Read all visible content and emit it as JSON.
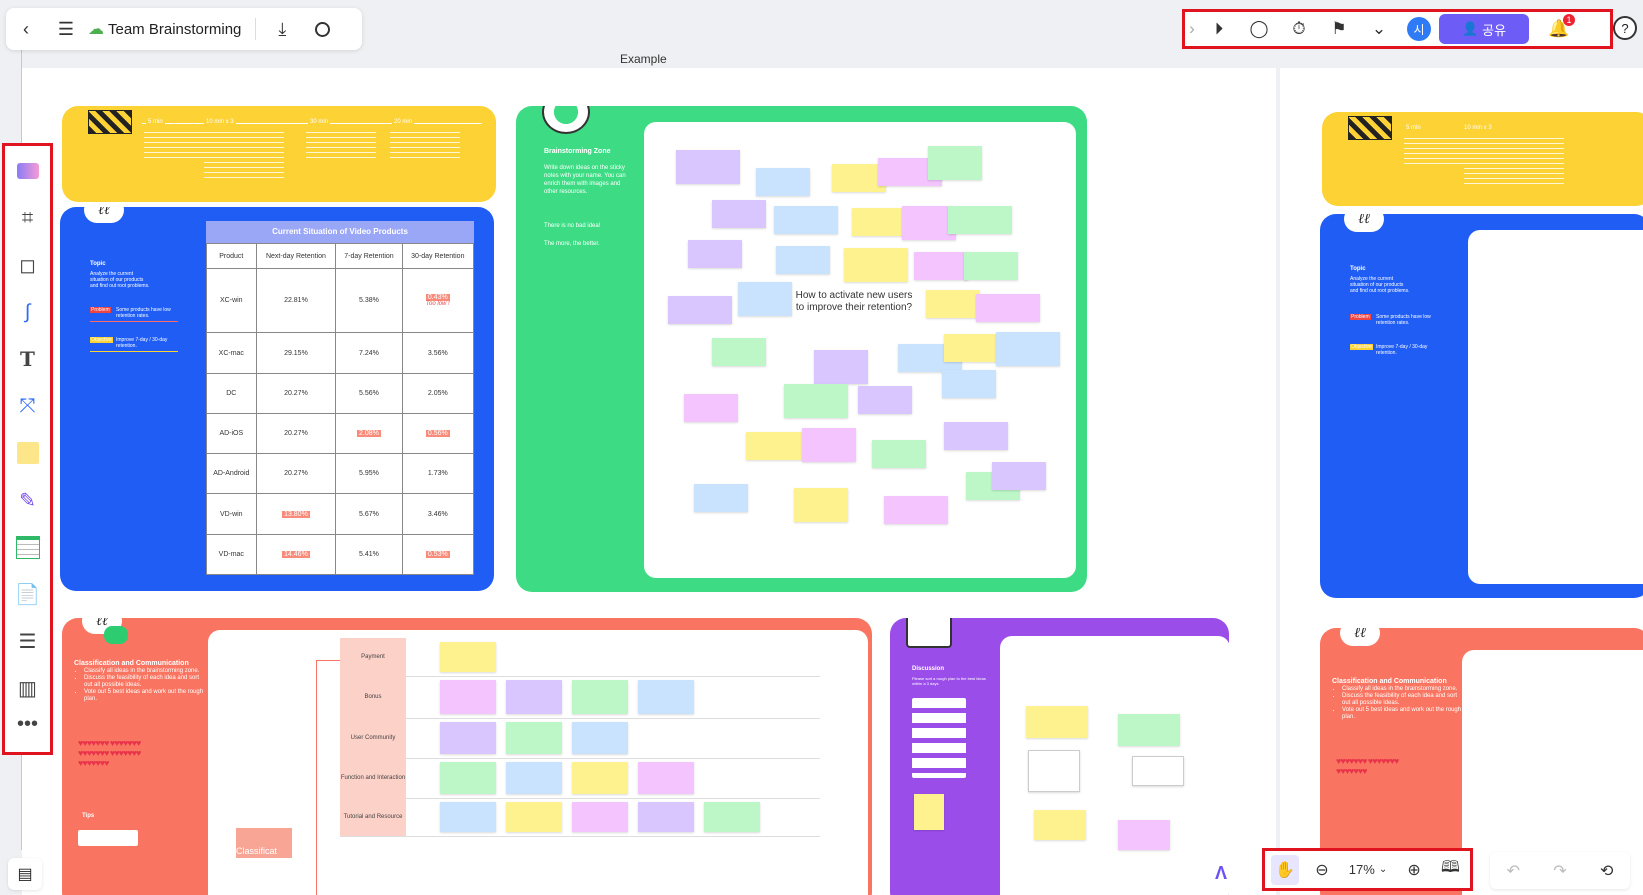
{
  "app": {
    "title": "Team Brainstorming",
    "frame_label": "Example"
  },
  "topbar": {
    "back_icon": "chevron-left-icon",
    "menu_icon": "hamburger-icon",
    "cloud_icon": "cloud-icon",
    "download_icon": "download-icon",
    "search_icon": "search-icon"
  },
  "right_toolbar": {
    "share_label": "공유",
    "avatar_initial": "시",
    "notification_count": "1",
    "help_label": "?"
  },
  "zoom": {
    "level": "17%"
  },
  "board": {
    "current_situation": {
      "title": "Current Situation of Video Products",
      "headers": [
        "Product",
        "Next-day Retention",
        "7-day Retention",
        "30-day Retention"
      ],
      "rows": [
        [
          "XC-win",
          "22.81%",
          "5.38%",
          "0.43%"
        ],
        [
          "XC-mac",
          "29.15%",
          "7.24%",
          "3.56%"
        ],
        [
          "DC",
          "20.27%",
          "5.56%",
          "2.05%"
        ],
        [
          "AD-iOS",
          "20.27%",
          "2.08%",
          "0.56%"
        ],
        [
          "AD-Android",
          "20.27%",
          "5.95%",
          "1.73%"
        ],
        [
          "VD-win",
          "13.80%",
          "5.67%",
          "3.46%"
        ],
        [
          "VD-mac",
          "14.46%",
          "5.41%",
          "0.53%"
        ]
      ],
      "annotation": "Too low !",
      "topic_label": "Topic",
      "topic_text": "Analyze the current situation of our products and find out root problems.",
      "problem_label": "Problem",
      "problem_text": "Some products have low retention rates.",
      "objective_label": "Objective",
      "objective_text": "Improve 7-day / 30-day retention."
    },
    "timeline": {
      "steps": [
        "5 min",
        "10 min x 3",
        "30 min",
        "20 min"
      ]
    },
    "brainstorm": {
      "title": "Brainstorming Zone",
      "text1": "Write down ideas on the sticky notes with your name. You can enrich them with images and other resources.",
      "text2": "There is no bad idea!",
      "text3": "The more, the better.",
      "question": "How to activate new users to improve their retention?"
    },
    "classification": {
      "title": "Classification and Communication",
      "bullets": [
        "Classify all ideas in the brainstorming zone.",
        "Discuss the feasibility of each idea and sort out all possible ideas.",
        "Vote out 5 best ideas and work out the rough plan."
      ],
      "tips_label": "Tips",
      "stamp_label": "Classificat",
      "categories": [
        "Payment",
        "Bonus",
        "User Community",
        "Function and Interaction",
        "Tutorial and Resource"
      ]
    },
    "discussion": {
      "title": "Discussion",
      "text": "Please sort a rough plan to the best ideas within a 3 days"
    }
  }
}
